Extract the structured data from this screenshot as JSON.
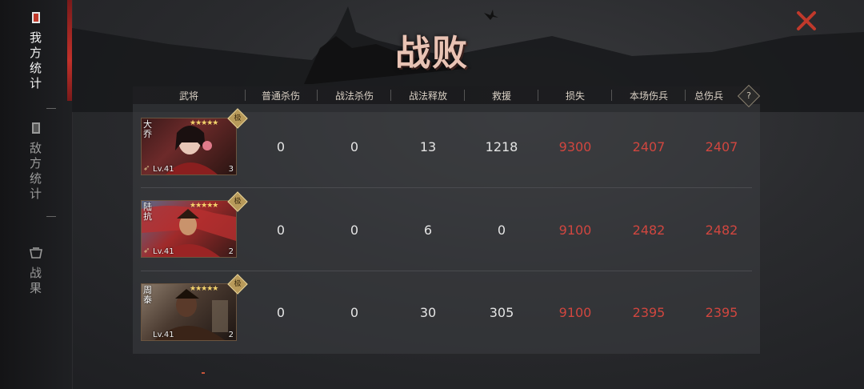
{
  "title": "战败",
  "sidebar": {
    "tabs": [
      {
        "label": [
          "我",
          "方",
          "统",
          "计"
        ],
        "active": true,
        "icon": "card-icon"
      },
      {
        "label": [
          "敌",
          "方",
          "统",
          "计"
        ],
        "active": false,
        "icon": "card-icon"
      },
      {
        "label": [
          "战",
          "果"
        ],
        "active": false,
        "icon": "basket-icon"
      }
    ]
  },
  "table": {
    "headers": [
      "武将",
      "普通杀伤",
      "战法杀伤",
      "战法释放",
      "救援",
      "损失",
      "本场伤兵",
      "总伤兵"
    ],
    "help_label": "?",
    "rows": [
      {
        "general": {
          "name": "大乔",
          "level": "Lv.41",
          "count": "3",
          "stars": "★★★★★",
          "badge": "极"
        },
        "normal_kill": "0",
        "tactic_kill": "0",
        "tactic_cast": "13",
        "rescue": "1218",
        "loss": "9300",
        "battle_wounded": "2407",
        "total_wounded": "2407"
      },
      {
        "general": {
          "name": "陆抗",
          "level": "Lv.41",
          "count": "2",
          "stars": "★★★★★",
          "badge": "极"
        },
        "normal_kill": "0",
        "tactic_kill": "0",
        "tactic_cast": "6",
        "rescue": "0",
        "loss": "9100",
        "battle_wounded": "2482",
        "total_wounded": "2482"
      },
      {
        "general": {
          "name": "周泰",
          "level": "Lv.41",
          "count": "2",
          "stars": "★★★★★",
          "badge": "极"
        },
        "normal_kill": "0",
        "tactic_kill": "0",
        "tactic_cast": "30",
        "rescue": "305",
        "loss": "9100",
        "battle_wounded": "2395",
        "total_wounded": "2395"
      }
    ]
  },
  "colors": {
    "accent_red": "#d0463f",
    "close_red": "#c0392b",
    "title": "#e9c3b4"
  }
}
